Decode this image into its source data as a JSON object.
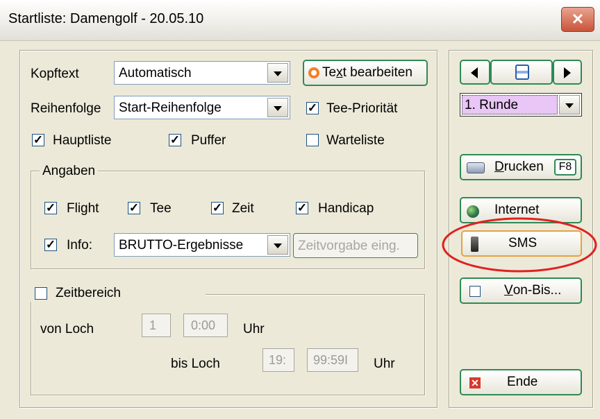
{
  "window": {
    "title": "Startliste: Damengolf - 20.05.10",
    "close_glyph": "✕"
  },
  "kopftext": {
    "label": "Kopftext",
    "value": "Automatisch"
  },
  "text_bearbeiten": {
    "prefix": "Te",
    "underlined": "x",
    "suffix": "t bearbeiten"
  },
  "reihenfolge": {
    "label": "Reihenfolge",
    "value": "Start-Reihenfolge"
  },
  "tee_prioritaet": {
    "label": "Tee-Priorität",
    "checked": true
  },
  "hauptliste": {
    "label": "Hauptliste",
    "checked": true
  },
  "puffer": {
    "label": "Puffer",
    "checked": true
  },
  "warteliste": {
    "label": "Warteliste",
    "checked": false
  },
  "angaben": {
    "legend": "Angaben",
    "flight": {
      "label": "Flight",
      "checked": true
    },
    "tee": {
      "label": "Tee",
      "checked": true
    },
    "zeit": {
      "label": "Zeit",
      "checked": true
    },
    "handicap": {
      "label": "Handicap",
      "checked": true
    },
    "info": {
      "label": "Info:",
      "checked": true
    },
    "info_value": "BRUTTO-Ergebnisse",
    "zeitvorgabe_label": "Zeitvorgabe eing."
  },
  "zeitbereich": {
    "label": "Zeitbereich",
    "checked": false,
    "von_loch_label": "von Loch",
    "von_loch_value": "1",
    "von_time_value": "0:00",
    "von_uhr": "Uhr",
    "bis_loch_label": "bis Loch",
    "bis_loch_value": "19:",
    "bis_time_value": "99:59I",
    "bis_uhr": "Uhr"
  },
  "right": {
    "runde_value": "1. Runde",
    "drucken_prefix": "",
    "drucken_underlined": "D",
    "drucken_suffix": "rucken",
    "drucken_key": "F8",
    "internet_label": "Internet",
    "sms_label": "SMS",
    "vonbis_underlined": "V",
    "vonbis_suffix": "on-Bis...",
    "ende_label": "Ende"
  },
  "colors": {
    "highlight_ring": "#e02020",
    "button_border": "#2d8a55",
    "runde_highlight": "#e8c6f5"
  }
}
